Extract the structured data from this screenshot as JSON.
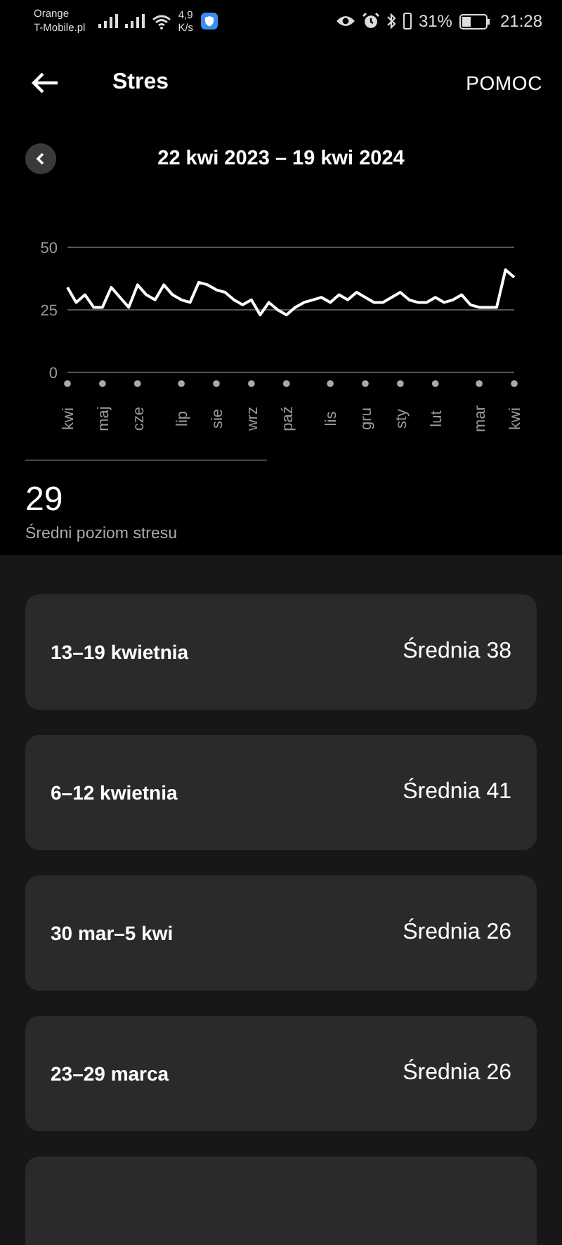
{
  "status_bar": {
    "carrier_1": "Orange",
    "carrier_2": "T-Mobile.pl",
    "speed_value": "4,9",
    "speed_unit": "K/s",
    "battery": "31%",
    "time": "21:28"
  },
  "header": {
    "title": "Stres",
    "help": "POMOC"
  },
  "date_range": "22 kwi 2023 – 19 kwi 2024",
  "chart_data": {
    "type": "line",
    "ylim": [
      0,
      50
    ],
    "yticks": [
      0,
      25,
      50
    ],
    "categories": [
      "kwi",
      null,
      null,
      null,
      "maj",
      null,
      null,
      null,
      "cze",
      null,
      null,
      null,
      null,
      "lip",
      null,
      null,
      null,
      "sie",
      null,
      null,
      null,
      "wrz",
      null,
      null,
      null,
      "paź",
      null,
      null,
      null,
      null,
      "lis",
      null,
      null,
      null,
      "gru",
      null,
      null,
      null,
      "sty",
      null,
      null,
      null,
      "lut",
      null,
      null,
      null,
      null,
      "mar",
      null,
      null,
      null,
      "kwi"
    ],
    "series": [
      {
        "color": "#ffffff",
        "values": [
          34,
          28,
          31,
          26,
          26,
          34,
          30,
          26,
          35,
          31,
          29,
          35,
          31,
          29,
          28,
          36,
          35,
          33,
          32,
          29,
          27,
          29,
          23,
          28,
          25,
          23,
          26,
          28,
          29,
          30,
          28,
          31,
          29,
          32,
          30,
          28,
          28,
          30,
          32,
          29,
          28,
          28,
          30,
          28,
          29,
          31,
          27,
          26,
          26,
          26,
          41,
          38
        ]
      }
    ]
  },
  "summary": {
    "value": "29",
    "label": "Średni poziom stresu"
  },
  "weeks": [
    {
      "range": "13–19 kwietnia",
      "average": "Średnia 38"
    },
    {
      "range": "6–12 kwietnia",
      "average": "Średnia 41"
    },
    {
      "range": "30 mar–5 kwi",
      "average": "Średnia 26"
    },
    {
      "range": "23–29 marca",
      "average": "Średnia 26"
    }
  ]
}
